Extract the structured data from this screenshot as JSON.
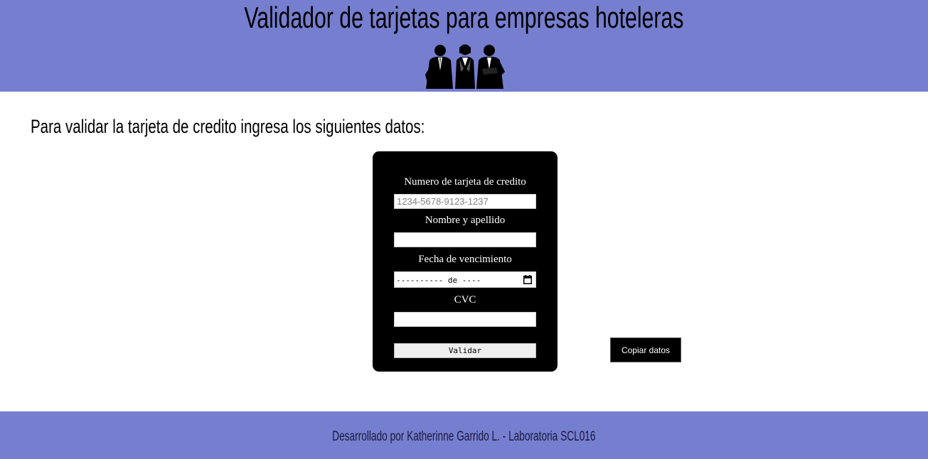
{
  "header": {
    "title": "Validador de tarjetas para empresas hoteleras",
    "logo_icon": "business-people-icon",
    "background_color": "#767ed0"
  },
  "main": {
    "intro_text": "Para validar la tarjeta de credito ingresa los siguientes datos:"
  },
  "form": {
    "card_number_label": "Numero de tarjeta de credito",
    "card_number_placeholder": "1234-5678-9123-1237",
    "card_number_value": "",
    "name_label": "Nombre y apellido",
    "name_value": "",
    "expiry_label": "Fecha de vencimiento",
    "expiry_display": "---------- de ----",
    "expiry_icon": "calendar-icon",
    "cvc_label": "CVC",
    "cvc_value": "",
    "validate_label": "Validar",
    "background_color": "#000000"
  },
  "actions": {
    "copy_label": "Copiar datos"
  },
  "footer": {
    "text": "Desarrollado por Katherinne Garrido L. - Laboratoria SCL016"
  }
}
